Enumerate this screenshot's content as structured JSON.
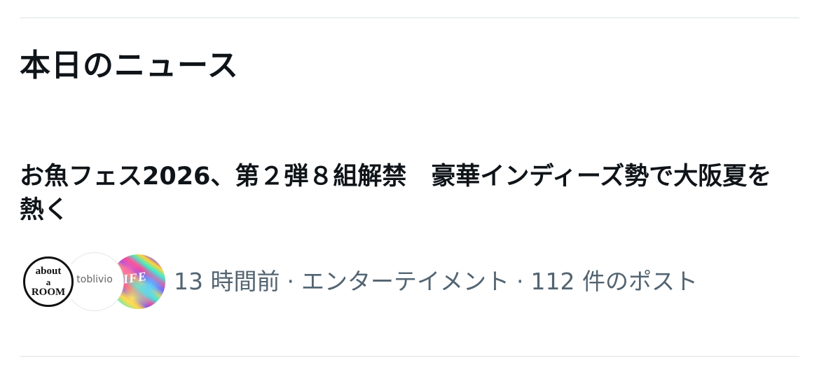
{
  "section": {
    "title": "本日のニュース"
  },
  "news_item": {
    "headline": "お魚フェス2026、第２弾８組解禁　豪華インディーズ勢で大阪夏を熱く",
    "time_ago": "13 時間前",
    "category": "エンターテイメント",
    "post_count": "112 件のポスト",
    "separator": "·",
    "avatars": [
      {
        "name": "about-a-room-avatar",
        "lines": [
          "about",
          "a",
          "ROOM"
        ]
      },
      {
        "name": "stoblivio-avatar",
        "text": "stoblivio"
      },
      {
        "name": "colorful-logo-avatar",
        "text": "LIFE"
      }
    ]
  },
  "colors": {
    "text_primary": "#0f1419",
    "text_secondary": "#536471",
    "divider": "#dfe3e6"
  }
}
